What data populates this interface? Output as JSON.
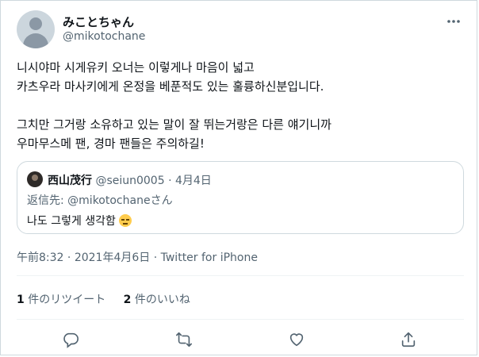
{
  "author": {
    "display_name": "みことちゃん",
    "handle": "@mikotochane"
  },
  "tweet": {
    "paragraphs": [
      [
        "니시야마 시게유키 오너는 이렇게나 마음이 넓고",
        "카츠우라 마사키에게 온정을 베푼적도 있는 훌륭하신분입니다."
      ],
      [
        "그치만 그거랑 소유하고 있는 말이 잘 뛰는거랑은 다른 얘기니까",
        "우마무스메 팬, 경마 팬들은 주의하길!"
      ]
    ]
  },
  "quoted_tweet": {
    "display_name": "西山茂行",
    "handle": "@seiun0005",
    "separator": "·",
    "date": "4月4日",
    "reply_prefix": "返信先: ",
    "reply_handle": "@mikotochane",
    "reply_suffix": "さん",
    "text": "나도 그렇게 생각함",
    "emoji": "relieved-face"
  },
  "timestamp": {
    "time": "午前8:32",
    "separator": "·",
    "date": "2021年4月6日",
    "source": "Twitter for iPhone"
  },
  "stats": {
    "retweets": {
      "count": "1",
      "label": "件のリツイート"
    },
    "likes": {
      "count": "2",
      "label": "件のいいね"
    }
  },
  "actions": [
    "reply-icon",
    "retweet-icon",
    "like-icon",
    "share-icon"
  ],
  "colors": {
    "text_primary": "#0f1419",
    "text_secondary": "#536471",
    "border": "#cfd9de",
    "divider": "#eff3f4"
  }
}
